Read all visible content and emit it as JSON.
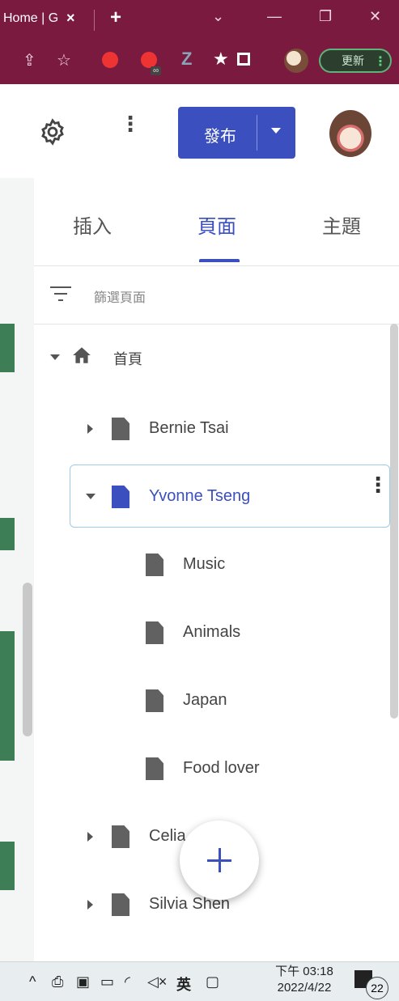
{
  "browser": {
    "tab_title": "Home | G",
    "tab_close": "×",
    "new_tab": "+",
    "minimize": "—",
    "restore": "❐",
    "close": "✕",
    "dropdown": "⌄"
  },
  "toolbar": {
    "update_label": "更新",
    "icons": [
      "share-icon",
      "bookmark-star-icon",
      "extension-red-icon",
      "extension-badge-icon",
      "extension-z-icon",
      "extensions-puzzle-icon",
      "sidebar-icon",
      "profile-avatar-icon"
    ]
  },
  "header": {
    "publish_label": "發布"
  },
  "panel": {
    "tabs": [
      {
        "label": "插入"
      },
      {
        "label": "頁面"
      },
      {
        "label": "主題"
      }
    ],
    "filter_placeholder": "篩選頁面",
    "tree": [
      {
        "label": "首頁",
        "level": 0,
        "expanded": true
      },
      {
        "label": "Bernie Tsai",
        "level": 1,
        "expanded": false
      },
      {
        "label": "Yvonne Tseng",
        "level": 1,
        "expanded": true,
        "selected": true
      },
      {
        "label": "Music",
        "level": 2
      },
      {
        "label": "Animals",
        "level": 2
      },
      {
        "label": "Japan",
        "level": 2
      },
      {
        "label": "Food lover",
        "level": 2
      },
      {
        "label": "Celia",
        "level": 1,
        "expanded": false
      },
      {
        "label": "Silvia Shen",
        "level": 1,
        "expanded": false
      }
    ]
  },
  "taskbar": {
    "ime": "英",
    "time": "下午 03:18",
    "date": "2022/4/22",
    "notifications": "22"
  },
  "colors": {
    "accent": "#3c4fbf",
    "browser_frame": "#7b1a3f"
  }
}
